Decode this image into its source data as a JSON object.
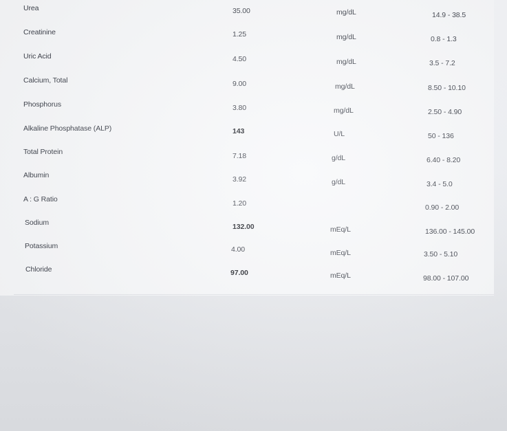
{
  "report": {
    "rows": [
      {
        "test": "Urea",
        "value": "35.00",
        "unit": "mg/dL",
        "range": "14.9 - 38.5",
        "flag": false
      },
      {
        "test": "Creatinine",
        "value": "1.25",
        "unit": "mg/dL",
        "range": "0.8 - 1.3",
        "flag": false
      },
      {
        "test": "Uric Acid",
        "value": "4.50",
        "unit": "mg/dL",
        "range": "3.5 - 7.2",
        "flag": false
      },
      {
        "test": "Calcium, Total",
        "value": "9.00",
        "unit": "mg/dL",
        "range": "8.50 - 10.10",
        "flag": false
      },
      {
        "test": "Phosphorus",
        "value": "3.80",
        "unit": "mg/dL",
        "range": "2.50 - 4.90",
        "flag": false
      },
      {
        "test": "Alkaline Phosphatase (ALP)",
        "value": "143",
        "unit": "U/L",
        "range": "50 - 136",
        "flag": true
      },
      {
        "test": "Total Protein",
        "value": "7.18",
        "unit": "g/dL",
        "range": "6.40 - 8.20",
        "flag": false
      },
      {
        "test": "Albumin",
        "value": "3.92",
        "unit": "g/dL",
        "range": "3.4 - 5.0",
        "flag": false
      },
      {
        "test": "A : G Ratio",
        "value": "1.20",
        "unit": "",
        "range": "0.90 - 2.00",
        "flag": false
      },
      {
        "test": "Sodium",
        "value": "132.00",
        "unit": "mEq/L",
        "range": "136.00 - 145.00",
        "flag": true
      },
      {
        "test": "Potassium",
        "value": "4.00",
        "unit": "mEq/L",
        "range": "3.50 - 5.10",
        "flag": false
      },
      {
        "test": "Chloride",
        "value": "97.00",
        "unit": "mEq/L",
        "range": "98.00 - 107.00",
        "flag": true
      }
    ]
  }
}
